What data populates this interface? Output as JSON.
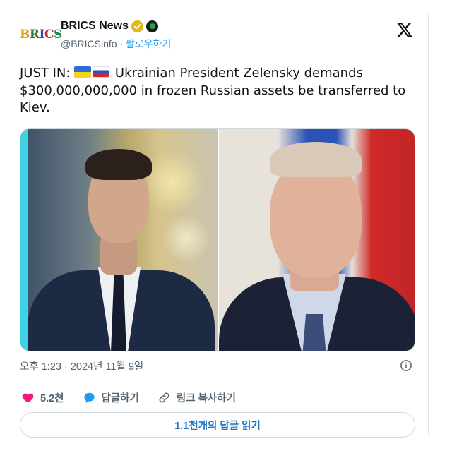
{
  "account": {
    "logo_text": "BRICS",
    "display_name": "BRICS News",
    "handle": "@BRICSinfo",
    "separator": " · ",
    "follow_label": "팔로우하기",
    "verified_badge_color": "#e2b719",
    "affiliate_badge_color": "#22a447"
  },
  "tweet": {
    "text_prefix": "JUST IN: ",
    "flags": [
      "ukraine-flag",
      "russia-flag"
    ],
    "text_body": " Ukrainian President Zelensky demands $300,000,000,000 in frozen Russian assets be transferred to Kiev."
  },
  "media": {
    "left_image": "zelensky-photo",
    "right_image": "putin-photo"
  },
  "meta": {
    "timestamp": "오후 1:23 · 2024년 11월 9일"
  },
  "actions": {
    "like_count": "5.2천",
    "reply_label": "답글하기",
    "copy_link_label": "링크 복사하기",
    "like_color": "#f91880",
    "reply_color": "#1d9bf0"
  },
  "replies_button": {
    "label": "1.1천개의 답글 읽기"
  }
}
